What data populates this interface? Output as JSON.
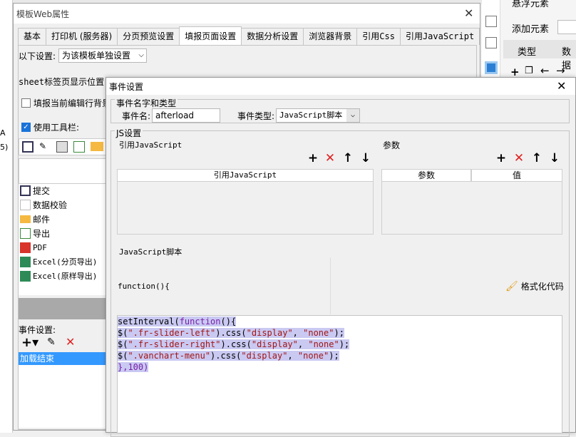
{
  "background": {
    "right_panel": {
      "title": "悬浮元素",
      "add_element": "添加元素",
      "tab_type": "类型",
      "tab_data": "数据"
    }
  },
  "back_window": {
    "title": "模板Web属性",
    "tabs": [
      "基本",
      "打印机 (服务器)",
      "分页预览设置",
      "填报页面设置",
      "数据分析设置",
      "浏览器背景",
      "引用Css",
      "引用JavaScript"
    ],
    "active_tab": 3,
    "settings_label": "以下设置:",
    "settings_value": "为该模板单独设置",
    "sheet_tab_label": "sheet标签页显示位置:",
    "fill_current_row": "填报当前编辑行背景",
    "use_toolbar": "使用工具栏:",
    "toolbar_buttons": [
      {
        "label": "提交",
        "icon": "save-icon"
      },
      {
        "label": "数据校验",
        "icon": "pencil-icon"
      },
      {
        "label": "邮件",
        "icon": "mail-icon"
      },
      {
        "label": "导出",
        "icon": "export-icon"
      },
      {
        "label": "PDF",
        "icon": "pdf-icon"
      },
      {
        "label": "Excel(分页导出)",
        "icon": "excel-icon"
      },
      {
        "label": "Excel(原样导出)",
        "icon": "excel-icon"
      }
    ],
    "event_settings_label": "事件设置:",
    "event_list": [
      "加载结束"
    ]
  },
  "dialog": {
    "title": "事件设置",
    "group_name_type": "事件名字和类型",
    "event_name_label": "事件名:",
    "event_name_value": "afterload",
    "event_type_label": "事件类型:",
    "event_type_value": "JavaScript脚本",
    "group_js": "JS设置",
    "ref_js_label": "引用JavaScript",
    "params_label": "参数",
    "ref_js_column": "引用JavaScript",
    "param_column": "参数",
    "value_column": "值",
    "script_label": "JavaScript脚本",
    "function_signature": "function(){",
    "format_code": "格式化代码",
    "code_lines": [
      "setInterval(function(){",
      "$(\".fr-slider-left\").css(\"display\", \"none\");",
      "$(\".fr-slider-right\").css(\"display\", \"none\");",
      "$(\".vanchart-menu\").css(\"display\", \"none\");",
      "},100)"
    ]
  },
  "colors": {
    "selection": "#c9c9f2",
    "list_selected": "#3399ff",
    "delete_red": "#e02020",
    "keyword": "#7a1fa8",
    "string": "#a31515"
  }
}
